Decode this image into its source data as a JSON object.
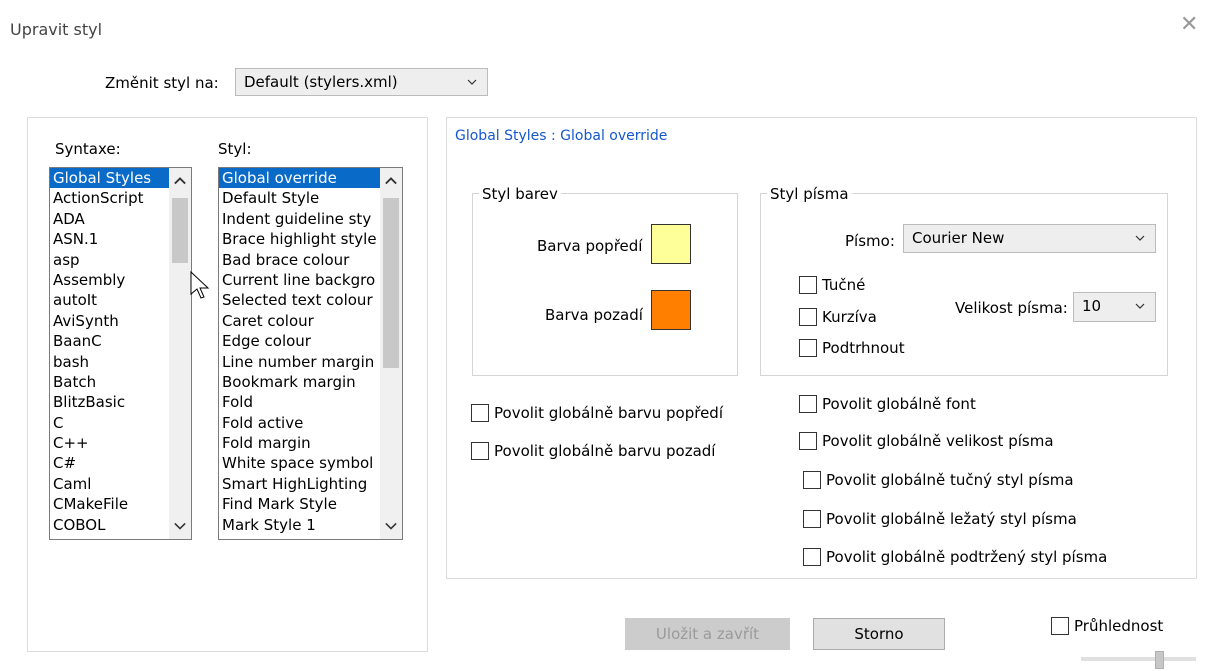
{
  "window": {
    "title": "Upravit styl"
  },
  "style_select": {
    "label": "Změnit styl na:",
    "value": "Default (stylers.xml)"
  },
  "syntax": {
    "label": "Syntaxe:",
    "items": [
      "Global Styles",
      "ActionScript",
      "ADA",
      "ASN.1",
      "asp",
      "Assembly",
      "autoIt",
      "AviSynth",
      "BaanC",
      "bash",
      "Batch",
      "BlitzBasic",
      "C",
      "C++",
      "C#",
      "Caml",
      "CMakeFile",
      "COBOL"
    ],
    "selected": 0
  },
  "style": {
    "label": "Styl:",
    "items": [
      "Global override",
      "Default Style",
      "Indent guideline sty",
      "Brace highlight style",
      "Bad brace colour",
      "Current line backgro",
      "Selected text colour",
      "Caret colour",
      "Edge colour",
      "Line number margin",
      "Bookmark margin",
      "Fold",
      "Fold active",
      "Fold margin",
      "White space symbol",
      "Smart HighLighting",
      "Find Mark Style",
      "Mark Style 1"
    ],
    "selected": 0
  },
  "header": "Global Styles : Global override",
  "color_group": {
    "title": "Styl barev",
    "fg_label": "Barva popředí",
    "bg_label": "Barva pozadí",
    "fg_color": "#ffff99",
    "bg_color": "#ff8000"
  },
  "font_group": {
    "title": "Styl písma",
    "font_label": "Písmo:",
    "font_value": "Courier New",
    "bold": "Tučné",
    "italic": "Kurzíva",
    "underline": "Podtrhnout",
    "size_label": "Velikost písma:",
    "size_value": "10"
  },
  "global": {
    "fg": "Povolit globálně barvu popředí",
    "bg": "Povolit globálně barvu pozadí",
    "font": "Povolit globálně font",
    "size": "Povolit globálně velikost písma",
    "bold": "Povolit globálně tučný styl písma",
    "italic": "Povolit globálně ležatý styl písma",
    "underline": "Povolit globálně podtržený styl písma"
  },
  "buttons": {
    "save": "Uložit a zavřít",
    "cancel": "Storno"
  },
  "transparency": {
    "label": "Průhlednost"
  }
}
